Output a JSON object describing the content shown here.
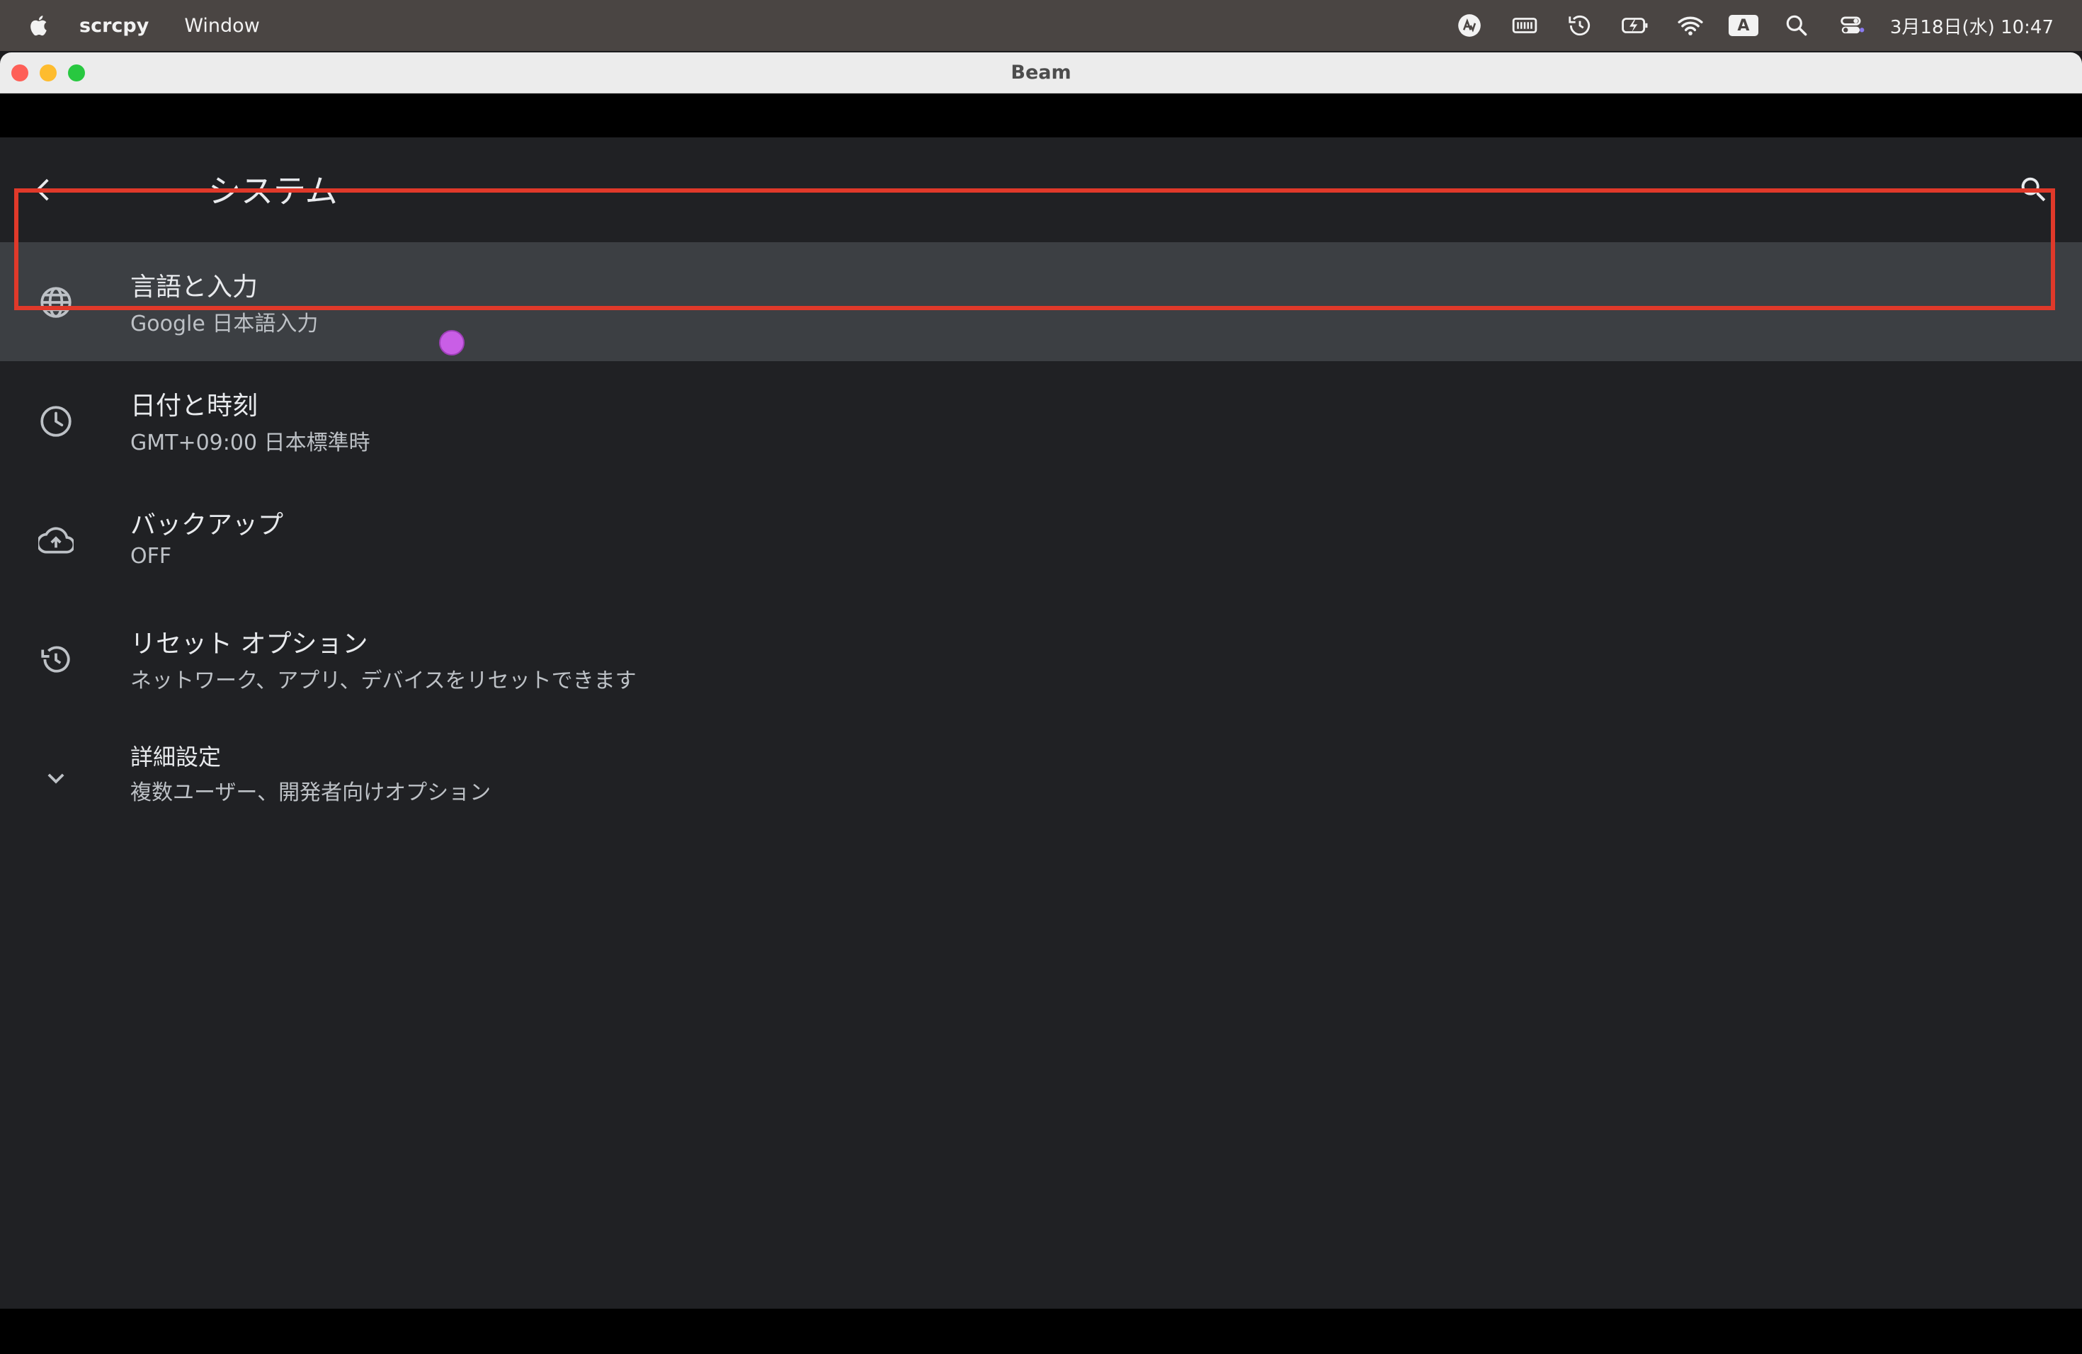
{
  "menubar": {
    "app_name": "scrcpy",
    "menus": [
      "Window"
    ],
    "status_icons": [
      "autofill-icon",
      "battery-meter-icon",
      "time-machine-icon",
      "battery-charging-icon",
      "wifi-icon",
      "input-source-icon",
      "spotlight-search-icon",
      "control-center-icon"
    ],
    "input_source": "A",
    "clock": "3月18日(水) 10:47"
  },
  "window": {
    "title": "Beam"
  },
  "android": {
    "page_title": "システム",
    "items": [
      {
        "title": "言語と入力",
        "subtitle": "Google 日本語入力",
        "icon": "globe-icon",
        "selected": true
      },
      {
        "title": "日付と時刻",
        "subtitle": "GMT+09:00 日本標準時",
        "icon": "clock-icon",
        "selected": false
      },
      {
        "title": "バックアップ",
        "subtitle": "OFF",
        "icon": "cloud-upload-icon",
        "selected": false
      },
      {
        "title": "リセット オプション",
        "subtitle": "ネットワーク、アプリ、デバイスをリセットできます",
        "icon": "reset-history-icon",
        "selected": false
      },
      {
        "title": "詳細設定",
        "subtitle": "複数ユーザー、開発者向けオプション",
        "icon": "chevron-down-icon",
        "selected": false
      }
    ]
  },
  "colors": {
    "highlight": "#e0392a",
    "cursor": "#c95ee6",
    "background": "#202124"
  }
}
